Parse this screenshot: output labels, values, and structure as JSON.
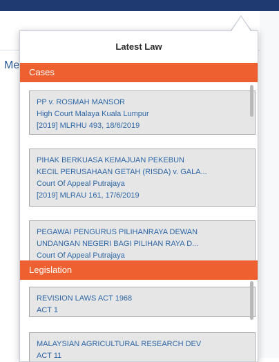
{
  "background": {
    "partial_label": "Me"
  },
  "popover": {
    "title": "Latest Law"
  },
  "cases": {
    "header": "Cases",
    "items": [
      {
        "title_lines": [
          "PP v. ROSMAH MANSOR"
        ],
        "court": "High Court Malaya Kuala Lumpur",
        "citation": "[2019] MLRHU 493, 18/6/2019"
      },
      {
        "title_lines": [
          "PIHAK BERKUASA KEMAJUAN PEKEBUN",
          "KECIL PERUSAHAAN GETAH (RISDA) v. GALA..."
        ],
        "court": "Court Of Appeal Putrajaya",
        "citation": "[2019] MLRAU 161, 17/6/2019"
      },
      {
        "title_lines": [
          "PEGAWAI PENGURUS PILIHANRAYA DEWAN",
          "UNDANGAN NEGERI BAGI PILIHAN RAYA D..."
        ],
        "court": "Court Of Appeal Putrajaya",
        "citation": ""
      }
    ]
  },
  "legislation": {
    "header": "Legislation",
    "items": [
      {
        "title": "REVISION LAWS ACT 1968",
        "act": "ACT 1"
      },
      {
        "title": "MALAYSIAN AGRICULTURAL RESEARCH DEV",
        "act": "ACT 11"
      }
    ]
  },
  "colors": {
    "accent": "#ee6030",
    "link": "#2d66a7",
    "topbar": "#1e3a6e",
    "card_bg": "#e6e6e6"
  }
}
